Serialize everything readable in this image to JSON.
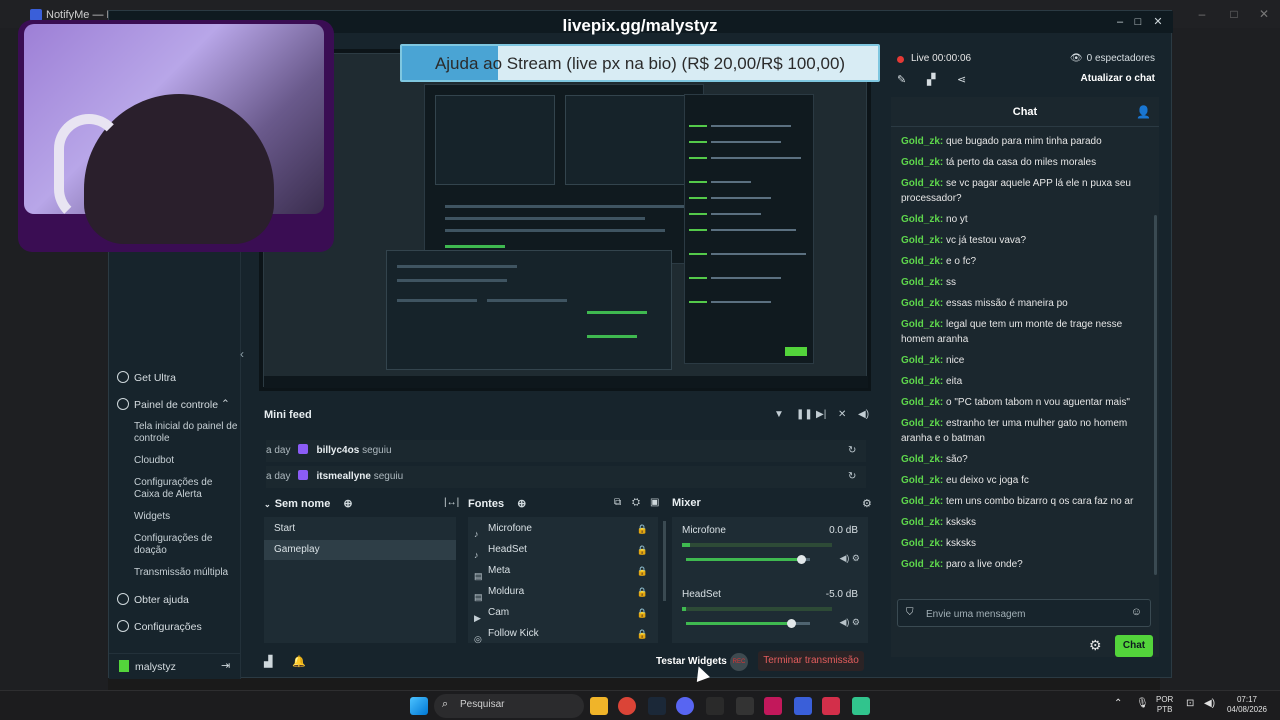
{
  "browser": {
    "tab_title": "NotifyMe — Disc"
  },
  "overlay": {
    "livepix_url": "livepix.gg/malystyz",
    "alert_text": "Ajuda ao Stream (live px na bio) (R$ 20,00/R$ 100,00)"
  },
  "sidebar": {
    "get_ultra": "Get Ultra",
    "control_panel": "Painel de controle",
    "sub_items": [
      "Tela inicial do painel de controle",
      "Cloudbot",
      "Configurações de Caixa de Alerta",
      "Widgets",
      "Configurações de doação",
      "Transmissão múltipla"
    ],
    "help": "Obter ajuda",
    "settings": "Configurações",
    "username": "malystyz"
  },
  "mini_feed": {
    "title": "Mini feed",
    "rows": [
      {
        "time": "a day",
        "user": "billyc4os",
        "action": "seguiu"
      },
      {
        "time": "a day",
        "user": "itsmeallyne",
        "action": "seguiu"
      }
    ]
  },
  "scenes": {
    "title": "Sem nome",
    "items": [
      "Start",
      "Gameplay"
    ],
    "selected": "Gameplay"
  },
  "sources": {
    "title": "Fontes",
    "items": [
      "Microfone",
      "HeadSet",
      "Meta",
      "Moldura",
      "Cam",
      "Follow Kick"
    ]
  },
  "mixer": {
    "title": "Mixer",
    "channels": [
      {
        "name": "Microfone",
        "db": "0.0 dB",
        "level": 0.93
      },
      {
        "name": "HeadSet",
        "db": "-5.0 dB",
        "level": 0.85
      }
    ]
  },
  "status_bar": {
    "test_widgets": "Testar Widgets",
    "rec_label": "REC",
    "end_stream": "Terminar transmissão"
  },
  "live": {
    "label": "Live",
    "time": "00:00:06",
    "viewers": "0 espectadores",
    "refresh_chat": "Atualizar o chat"
  },
  "chat": {
    "title": "Chat",
    "messages": [
      {
        "user": "Gold_zk",
        "text": "que bugado para mim tinha parado"
      },
      {
        "user": "Gold_zk",
        "text": "tá perto da casa do miles morales"
      },
      {
        "user": "Gold_zk",
        "text": "se vc pagar aquele APP lá ele n puxa seu processador?"
      },
      {
        "user": "Gold_zk",
        "text": "no yt"
      },
      {
        "user": "Gold_zk",
        "text": "vc já testou vava?"
      },
      {
        "user": "Gold_zk",
        "text": "e o fc?"
      },
      {
        "user": "Gold_zk",
        "text": "ss"
      },
      {
        "user": "Gold_zk",
        "text": "essas missão é maneira po"
      },
      {
        "user": "Gold_zk",
        "text": "legal que tem um monte de trage nesse homem aranha"
      },
      {
        "user": "Gold_zk",
        "text": "nice"
      },
      {
        "user": "Gold_zk",
        "text": "eita"
      },
      {
        "user": "Gold_zk",
        "text": "o \"PC tabom tabom n vou aguentar mais\""
      },
      {
        "user": "Gold_zk",
        "text": "estranho ter uma mulher gato no homem aranha e o batman"
      },
      {
        "user": "Gold_zk",
        "text": "são?"
      },
      {
        "user": "Gold_zk",
        "text": "eu deixo vc joga fc"
      },
      {
        "user": "Gold_zk",
        "text": "tem uns combo bizarro q os cara faz no ar"
      },
      {
        "user": "Gold_zk",
        "text": "ksksks"
      },
      {
        "user": "Gold_zk",
        "text": "ksksks"
      },
      {
        "user": "Gold_zk",
        "text": "paro a live onde?"
      }
    ],
    "input_placeholder": "Envie uma mensagem",
    "send_label": "Chat"
  },
  "taskbar": {
    "search_label": "Pesquisar",
    "lang_top": "POR",
    "lang_bottom": "PTB",
    "time": "07:17",
    "date": "04/08/2026"
  },
  "colors": {
    "accent_green": "#53d43b",
    "chat_username": "#5ed64c",
    "live_red": "#e53935",
    "end_stream_red": "#e35d5d",
    "alert_blue": "#4aa4d4"
  }
}
